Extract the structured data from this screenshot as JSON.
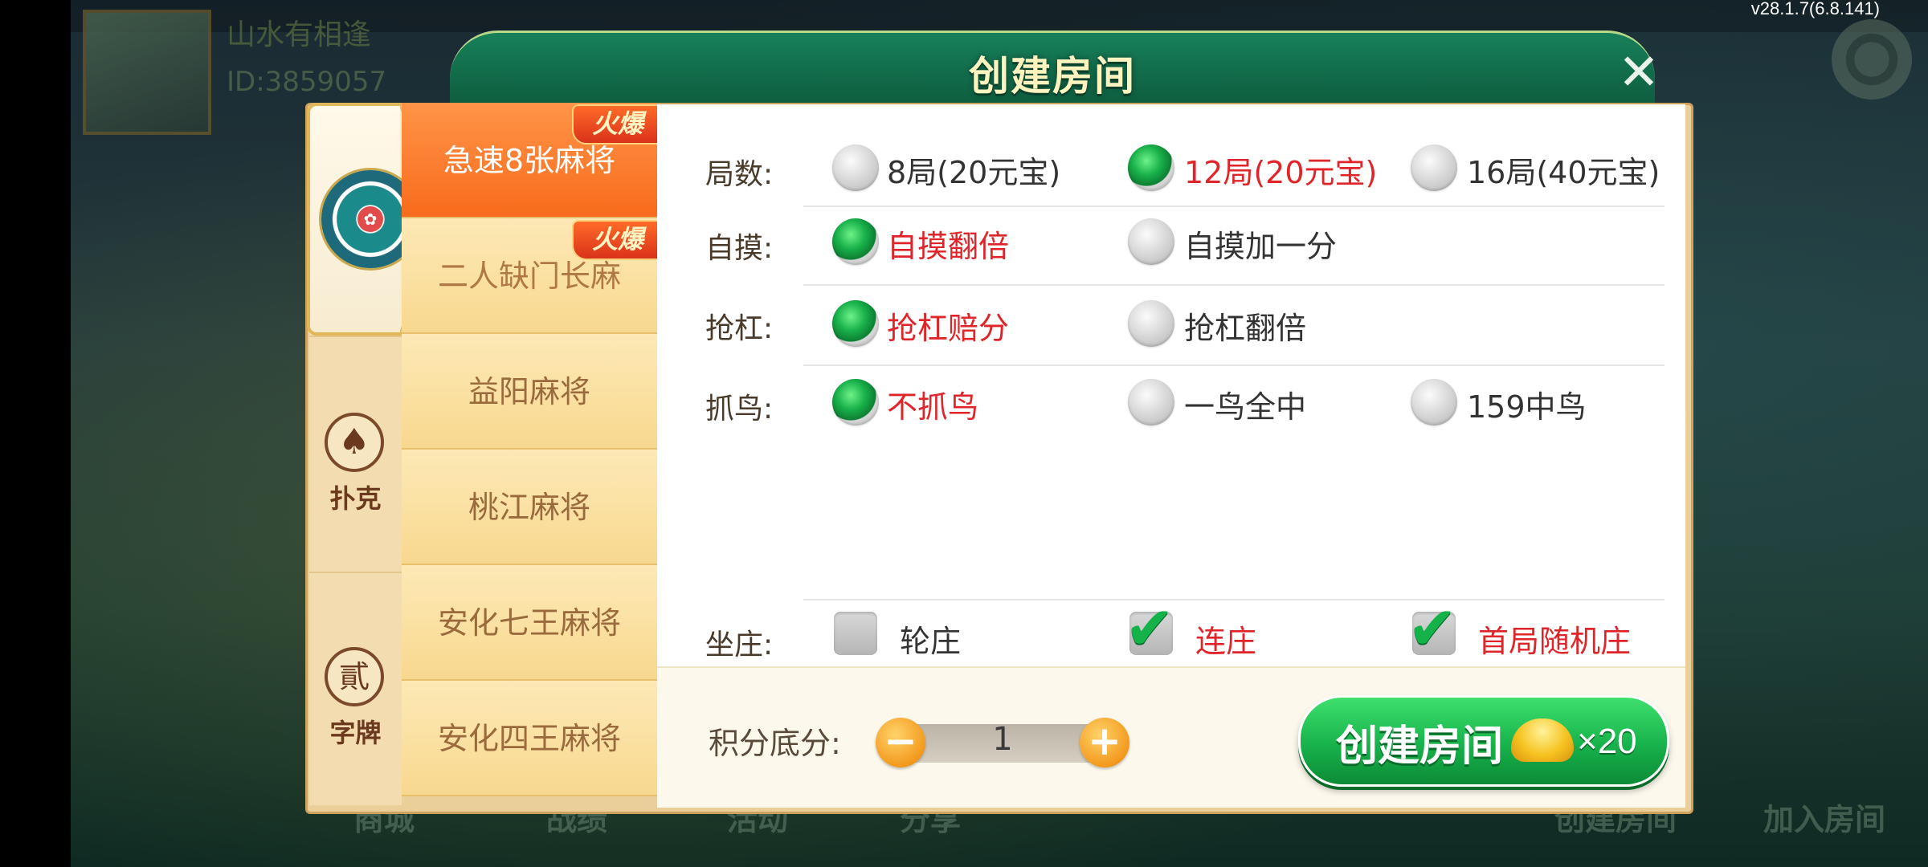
{
  "version": "v28.1.7(6.8.141)",
  "background": {
    "user_name": "山水有相逢",
    "user_id": "ID:3859057",
    "bottom_tabs": [
      "商城",
      "战绩",
      "活动",
      "分享",
      "创建房间",
      "加入房间"
    ]
  },
  "dialog": {
    "title": "创建房间",
    "close_icon": "close-icon",
    "categories": [
      {
        "label": "",
        "icon": "mahjong-icon",
        "selected": true
      },
      {
        "label": "扑克",
        "icon": "spade-icon",
        "glyph": "♠"
      },
      {
        "label": "字牌",
        "icon": "zipai-icon",
        "glyph": "貳"
      }
    ],
    "games": [
      {
        "label": "急速8张麻将",
        "hot": "火爆",
        "active": true
      },
      {
        "label": "二人缺门长麻",
        "hot": "火爆"
      },
      {
        "label": "益阳麻将"
      },
      {
        "label": "桃江麻将"
      },
      {
        "label": "安化七王麻将"
      },
      {
        "label": "安化四王麻将"
      }
    ],
    "options": {
      "rounds": {
        "label": "局数:",
        "choices": [
          {
            "text": "8局(20元宝)",
            "selected": false
          },
          {
            "text": "12局(20元宝)",
            "selected": true
          },
          {
            "text": "16局(40元宝)",
            "selected": false
          }
        ]
      },
      "zimo": {
        "label": "自摸:",
        "choices": [
          {
            "text": "自摸翻倍",
            "selected": true
          },
          {
            "text": "自摸加一分",
            "selected": false
          }
        ]
      },
      "qianggang": {
        "label": "抢杠:",
        "choices": [
          {
            "text": "抢杠赔分",
            "selected": true
          },
          {
            "text": "抢杠翻倍",
            "selected": false
          }
        ]
      },
      "zhuaniao": {
        "label": "抓鸟:",
        "choices": [
          {
            "text": "不抓鸟",
            "selected": true
          },
          {
            "text": "一鸟全中",
            "selected": false
          },
          {
            "text": "159中鸟",
            "selected": false
          }
        ]
      },
      "zuozhuang": {
        "label": "坐庄:",
        "choices": [
          {
            "text": "轮庄",
            "checked": false
          },
          {
            "text": "连庄",
            "checked": true
          },
          {
            "text": "首局随机庄",
            "checked": true
          }
        ]
      }
    },
    "score": {
      "label": "积分底分:",
      "value": "1",
      "minus": "−",
      "plus": "+"
    },
    "create_button": {
      "label": "创建房间",
      "cost": "×20",
      "icon": "gold-ingot-icon"
    }
  },
  "colors": {
    "header_green": "#0d5c3e",
    "selected_text": "#e0252a",
    "active_game": "#f86b1c",
    "button_green": "#17b24b"
  }
}
